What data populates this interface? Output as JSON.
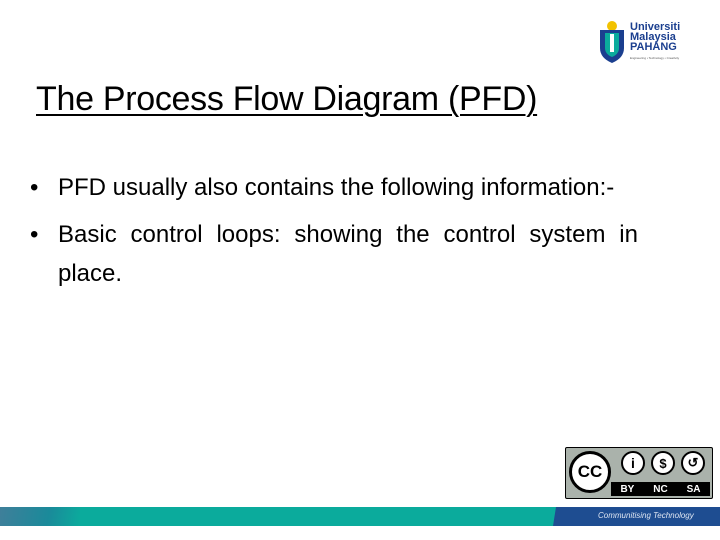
{
  "logo": {
    "name_line1": "Universiti",
    "name_line2": "Malaysia",
    "name_line3": "PAHANG",
    "tagline": "Engineering • Technology • Creativity",
    "colors": {
      "blue": "#1b3f8f",
      "yellow": "#f2c200",
      "teal": "#0bab9c"
    }
  },
  "slide": {
    "title": "The Process Flow Diagram (PFD)",
    "bullets": [
      "PFD usually also contains the following information:-",
      "Basic control loops: showing the control system in place."
    ]
  },
  "license": {
    "cc": "CC",
    "by": "BY",
    "nc": "NC",
    "sa": "SA",
    "icons": [
      "cc-icon",
      "attribution-icon",
      "noncommercial-icon",
      "sharealike-icon"
    ]
  },
  "footer": {
    "tagline": "Communitising Technology",
    "colors": {
      "teal": "#0bab9c",
      "blue": "#1e4d91"
    }
  }
}
